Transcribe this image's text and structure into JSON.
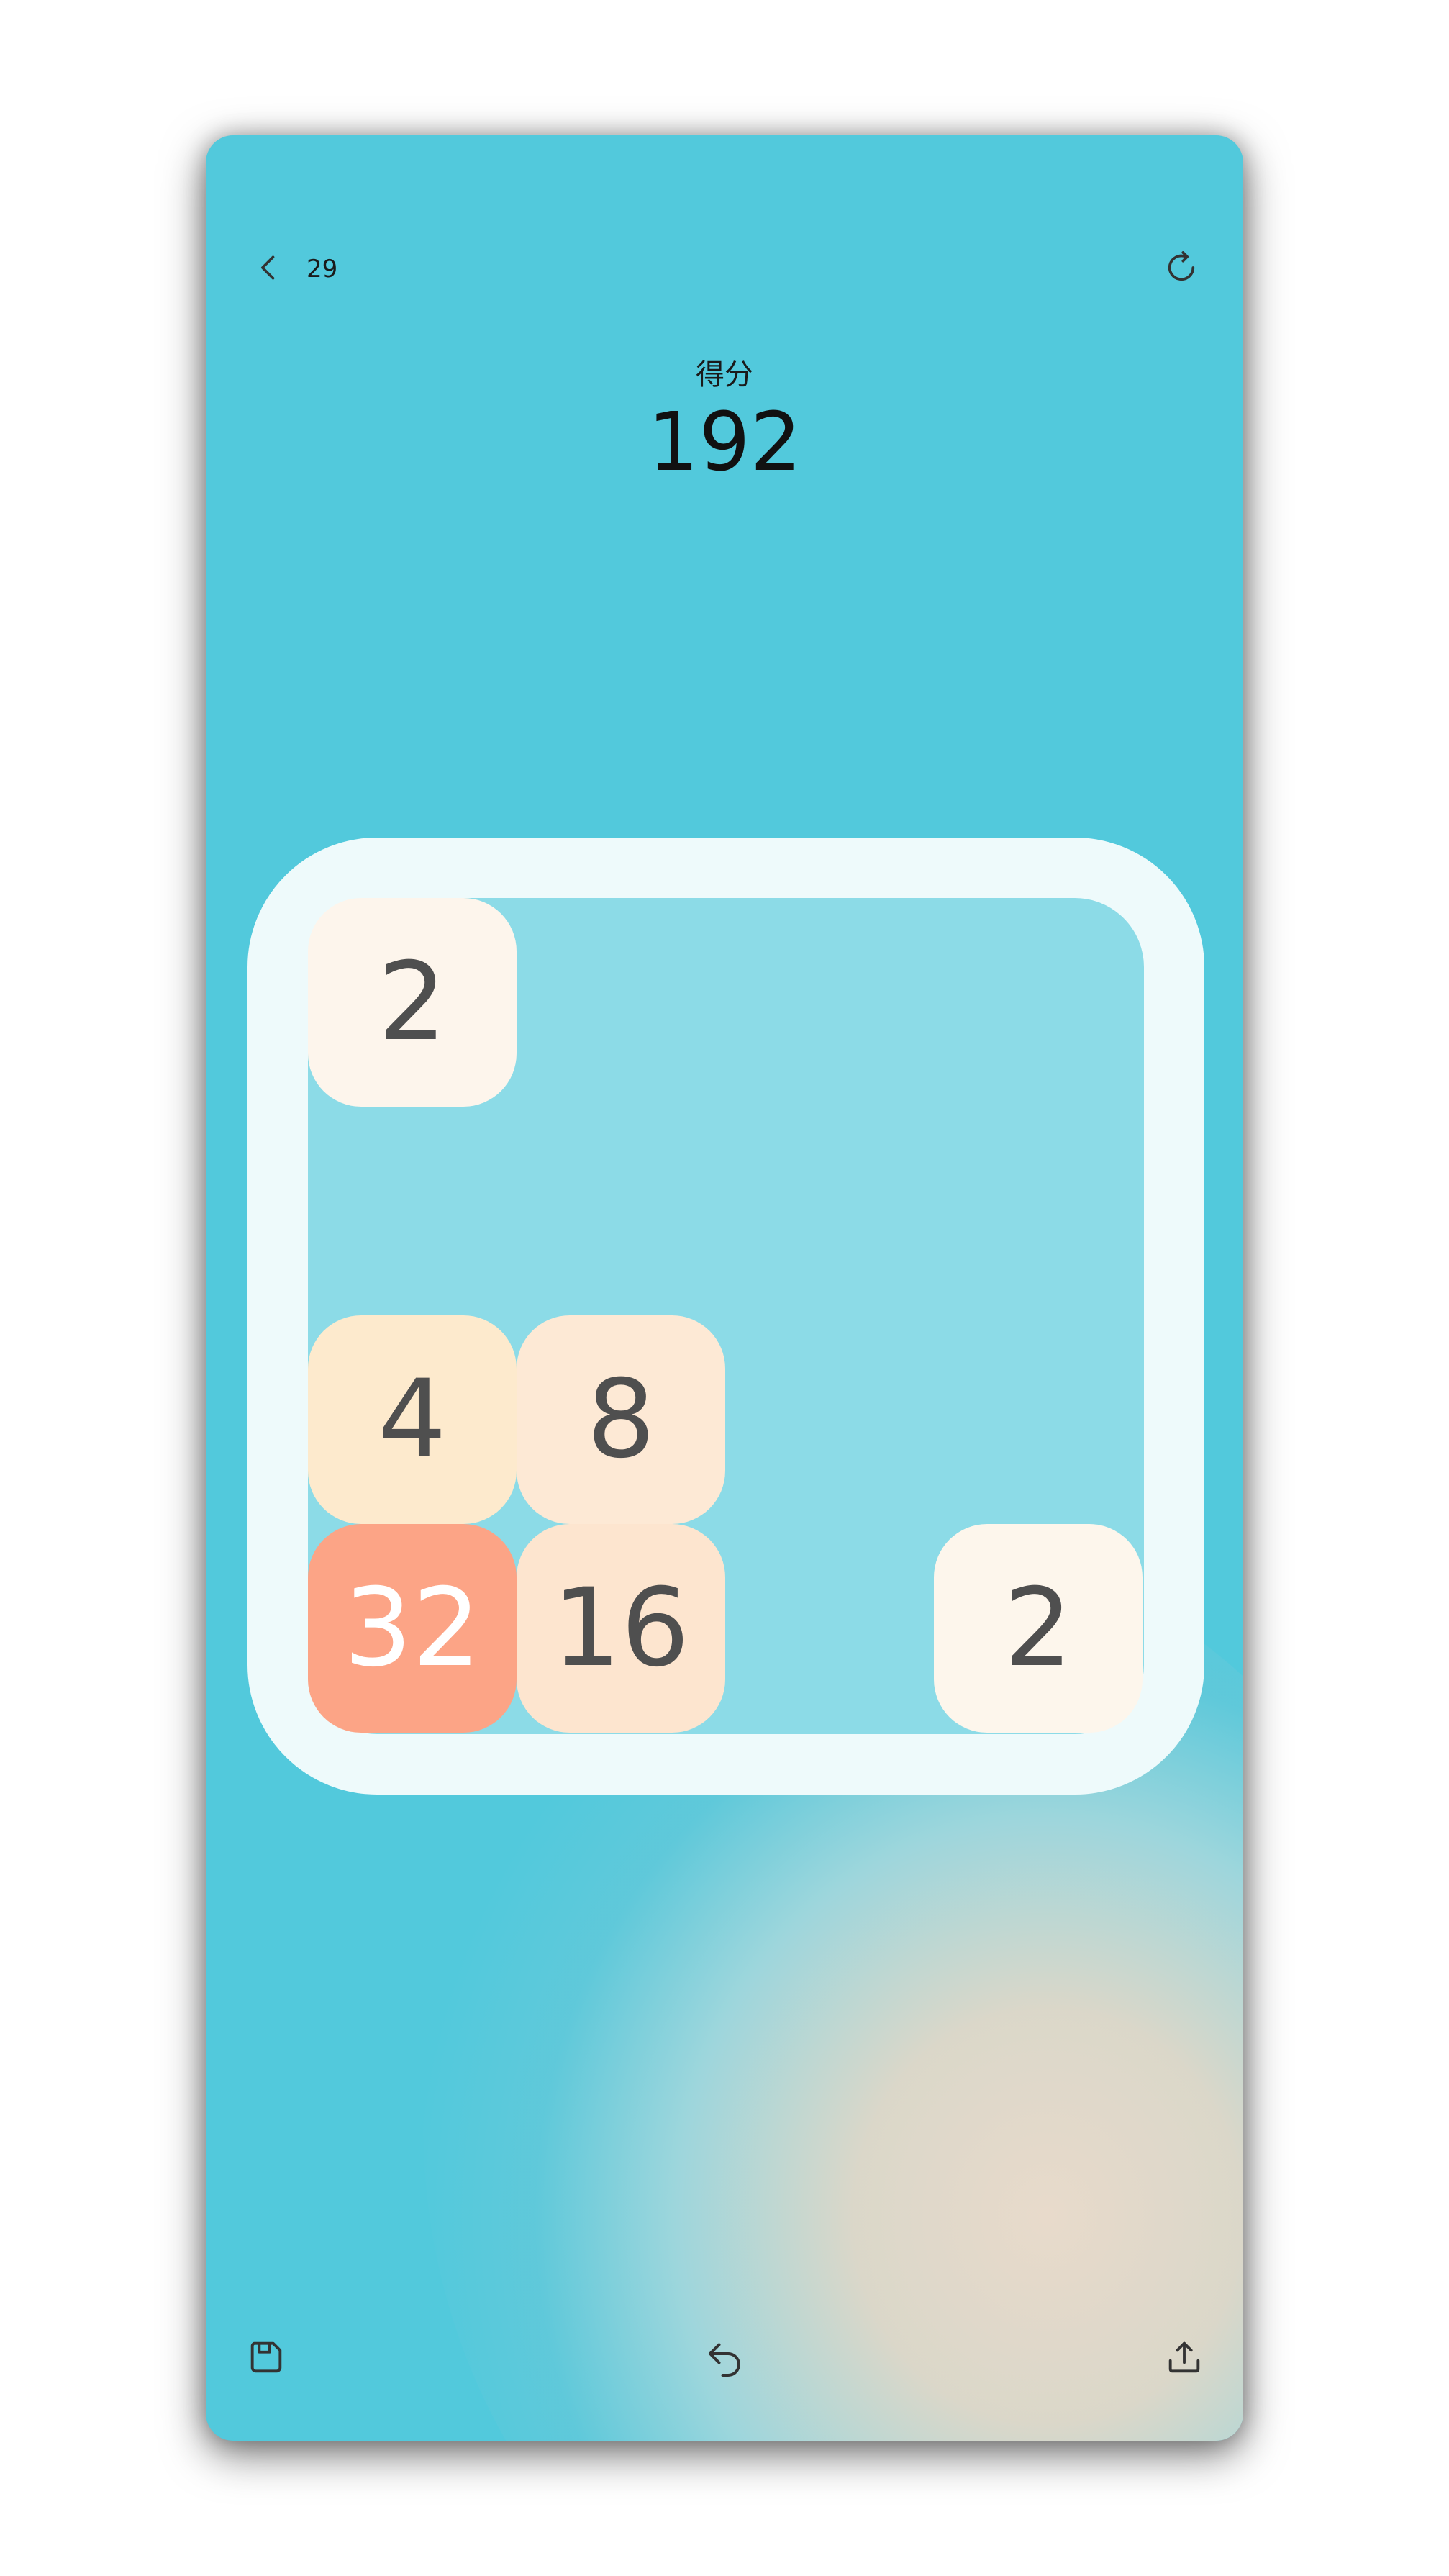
{
  "header": {
    "back_icon": "chevron-left-icon",
    "moves": "29",
    "restart_icon": "refresh-icon"
  },
  "score": {
    "label": "得分",
    "value": "192"
  },
  "colors": {
    "background": "#52c9dc",
    "board_border": "#eefafb",
    "board_fill": "#8cdbe7",
    "tile_text_dark": "#4f4f4f",
    "tile_text_light": "#ffffff"
  },
  "board": {
    "rows": 4,
    "cols": 4,
    "tiles": [
      {
        "row": 0,
        "col": 0,
        "value": "2",
        "color": "#fdf5ec",
        "text_color": "#4f4f4f"
      },
      {
        "row": 2,
        "col": 0,
        "value": "4",
        "color": "#fdeacd",
        "text_color": "#4f4f4f"
      },
      {
        "row": 2,
        "col": 1,
        "value": "8",
        "color": "#fde9d5",
        "text_color": "#4f4f4f"
      },
      {
        "row": 3,
        "col": 0,
        "value": "32",
        "color": "#fca486",
        "text_color": "#ffffff"
      },
      {
        "row": 3,
        "col": 1,
        "value": "16",
        "color": "#fde5cf",
        "text_color": "#4f4f4f"
      },
      {
        "row": 3,
        "col": 3,
        "value": "2",
        "color": "#fdf6ec",
        "text_color": "#4f4f4f"
      }
    ]
  },
  "footer": {
    "save_icon": "save-icon",
    "undo_icon": "undo-icon",
    "share_icon": "share-icon"
  }
}
